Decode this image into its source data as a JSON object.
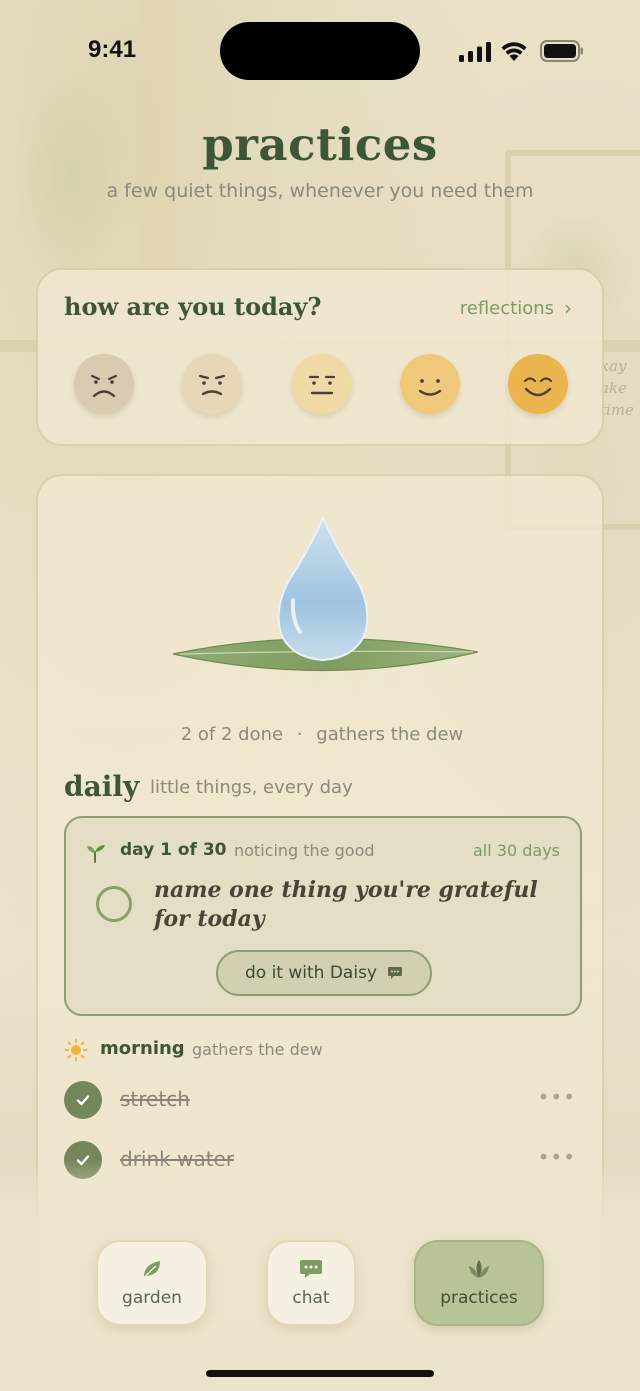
{
  "status": {
    "time": "9:41"
  },
  "header": {
    "title": "practices",
    "subtitle": "a few quiet things, whenever you need them"
  },
  "mood": {
    "question": "how are you today?",
    "reflections_label": "reflections",
    "faces": [
      "very-sad-face-icon",
      "sad-face-icon",
      "neutral-face-icon",
      "content-face-icon",
      "happy-face-icon"
    ]
  },
  "dew": {
    "progress_text": "2 of 2 done",
    "separator": "·",
    "status_text": "gathers the dew"
  },
  "daily": {
    "heading": "daily",
    "subheading": "little things, every day",
    "challenge": {
      "day_label": "day 1 of 30",
      "theme": "noticing the good",
      "all_days_label": "all 30 days",
      "prompt": "name one thing you're grateful for today",
      "button_label": "do it with Daisy"
    }
  },
  "morning": {
    "heading": "morning",
    "subheading": "gathers the dew",
    "tasks": [
      {
        "label": "stretch",
        "done": true
      },
      {
        "label": "drink water",
        "done": true
      }
    ]
  },
  "tabs": [
    {
      "label": "garden",
      "icon": "leaf-icon",
      "active": false
    },
    {
      "label": "chat",
      "icon": "chat-bubble-icon",
      "active": false
    },
    {
      "label": "practices",
      "icon": "lotus-icon",
      "active": true
    }
  ],
  "background_sign": [
    "kay",
    "ake",
    "time"
  ],
  "colors": {
    "accent_green": "#3d5635",
    "sage": "#7f9a66",
    "active_tab": "#b8c498",
    "background": "#ece4cc"
  }
}
